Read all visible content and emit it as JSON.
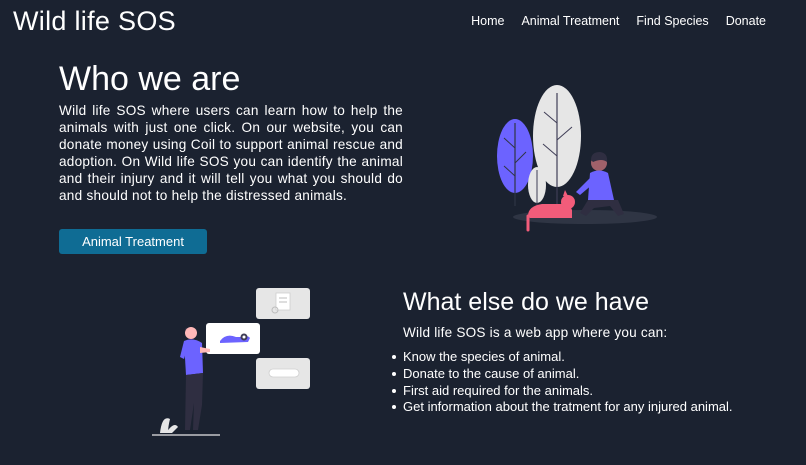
{
  "header": {
    "brand": "Wild life SOS",
    "nav": [
      {
        "label": "Home"
      },
      {
        "label": "Animal Treatment"
      },
      {
        "label": "Find Species"
      },
      {
        "label": "Donate"
      }
    ]
  },
  "who": {
    "title": "Who we are",
    "text": "Wild life SOS where users can learn how to help the animals with just one click. On our website, you can donate money using Coil to support animal rescue and adoption. On Wild life SOS you can identify the animal and their injury and it will tell you what you should do and should not to help the distressed animals.",
    "button_label": "Animal Treatment"
  },
  "what": {
    "title": "What else do we have",
    "intro": "Wild life SOS is a web app where you can:",
    "items": [
      "Know the species of animal.",
      "Donate to the cause of animal.",
      "First aid required for the animals.",
      "Get information about the tratment for any injured animal."
    ]
  },
  "colors": {
    "background": "#1b2230",
    "button": "#0f6c94",
    "accent_purple": "#6c63ff",
    "accent_pink": "#f25c7a"
  },
  "icons": {
    "top_illustration": "person-with-cat-illustration",
    "bottom_illustration": "person-with-cards-illustration"
  }
}
